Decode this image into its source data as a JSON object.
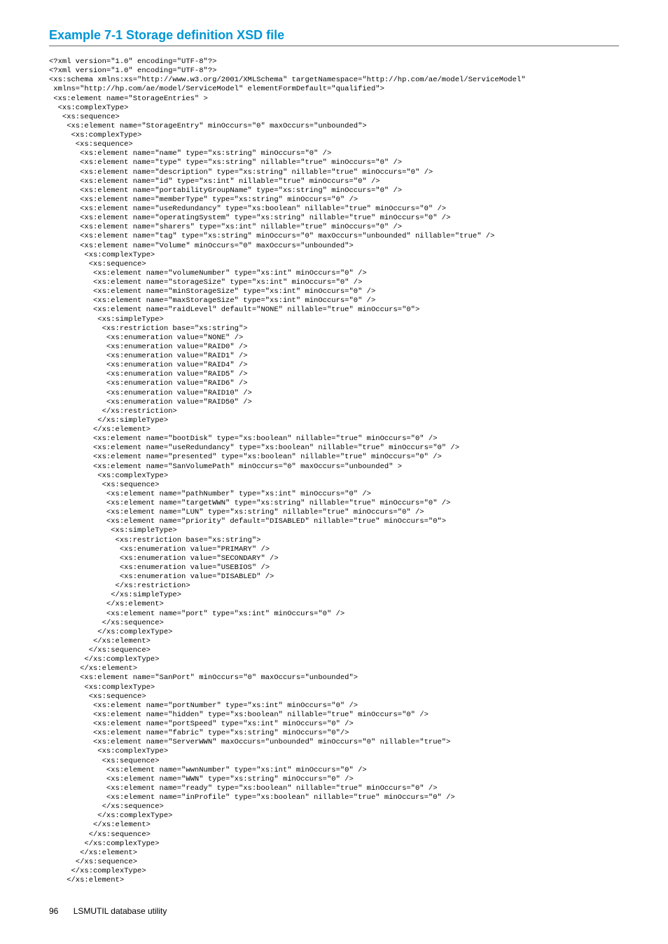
{
  "heading": "Example 7-1 Storage definition XSD file",
  "code": "<?xml version=\"1.0\" encoding=\"UTF-8\"?>\n<?xml version=\"1.0\" encoding=\"UTF-8\"?>\n<xs:schema xmlns:xs=\"http://www.w3.org/2001/XMLSchema\" targetNamespace=\"http://hp.com/ae/model/ServiceModel\"\n xmlns=\"http://hp.com/ae/model/ServiceModel\" elementFormDefault=\"qualified\">\n <xs:element name=\"StorageEntries\" >\n  <xs:complexType>\n   <xs:sequence>\n    <xs:element name=\"StorageEntry\" minOccurs=\"0\" maxOccurs=\"unbounded\">\n     <xs:complexType>\n      <xs:sequence>\n       <xs:element name=\"name\" type=\"xs:string\" minOccurs=\"0\" />\n       <xs:element name=\"type\" type=\"xs:string\" nillable=\"true\" minOccurs=\"0\" />\n       <xs:element name=\"description\" type=\"xs:string\" nillable=\"true\" minOccurs=\"0\" />\n       <xs:element name=\"id\" type=\"xs:int\" nillable=\"true\" minOccurs=\"0\" />\n       <xs:element name=\"portabilityGroupName\" type=\"xs:string\" minOccurs=\"0\" />\n       <xs:element name=\"memberType\" type=\"xs:string\" minOccurs=\"0\" />\n       <xs:element name=\"useRedundancy\" type=\"xs:boolean\" nillable=\"true\" minOccurs=\"0\" />\n       <xs:element name=\"operatingSystem\" type=\"xs:string\" nillable=\"true\" minOccurs=\"0\" />\n       <xs:element name=\"sharers\" type=\"xs:int\" nillable=\"true\" minOccurs=\"0\" />\n       <xs:element name=\"tag\" type=\"xs:string\" minOccurs=\"0\" maxOccurs=\"unbounded\" nillable=\"true\" />\n       <xs:element name=\"Volume\" minOccurs=\"0\" maxOccurs=\"unbounded\">\n        <xs:complexType>\n         <xs:sequence>\n          <xs:element name=\"volumeNumber\" type=\"xs:int\" minOccurs=\"0\" />\n          <xs:element name=\"storageSize\" type=\"xs:int\" minOccurs=\"0\" />\n          <xs:element name=\"minStorageSize\" type=\"xs:int\" minOccurs=\"0\" />\n          <xs:element name=\"maxStorageSize\" type=\"xs:int\" minOccurs=\"0\" />\n          <xs:element name=\"raidLevel\" default=\"NONE\" nillable=\"true\" minOccurs=\"0\">\n           <xs:simpleType>\n            <xs:restriction base=\"xs:string\">\n             <xs:enumeration value=\"NONE\" />\n             <xs:enumeration value=\"RAID0\" />\n             <xs:enumeration value=\"RAID1\" />\n             <xs:enumeration value=\"RAID4\" />\n             <xs:enumeration value=\"RAID5\" />\n             <xs:enumeration value=\"RAID6\" />\n             <xs:enumeration value=\"RAID10\" />\n             <xs:enumeration value=\"RAID50\" />\n            </xs:restriction>\n           </xs:simpleType>\n          </xs:element>\n          <xs:element name=\"bootDisk\" type=\"xs:boolean\" nillable=\"true\" minOccurs=\"0\" />\n          <xs:element name=\"useRedundancy\" type=\"xs:boolean\" nillable=\"true\" minOccurs=\"0\" />\n          <xs:element name=\"presented\" type=\"xs:boolean\" nillable=\"true\" minOccurs=\"0\" />\n          <xs:element name=\"SanVolumePath\" minOccurs=\"0\" maxOccurs=\"unbounded\" >\n           <xs:complexType>\n            <xs:sequence>\n             <xs:element name=\"pathNumber\" type=\"xs:int\" minOccurs=\"0\" />\n             <xs:element name=\"targetWWN\" type=\"xs:string\" nillable=\"true\" minOccurs=\"0\" />\n             <xs:element name=\"LUN\" type=\"xs:string\" nillable=\"true\" minOccurs=\"0\" />\n             <xs:element name=\"priority\" default=\"DISABLED\" nillable=\"true\" minOccurs=\"0\">\n              <xs:simpleType>\n               <xs:restriction base=\"xs:string\">\n                <xs:enumeration value=\"PRIMARY\" />\n                <xs:enumeration value=\"SECONDARY\" />\n                <xs:enumeration value=\"USEBIOS\" />\n                <xs:enumeration value=\"DISABLED\" />\n               </xs:restriction>\n              </xs:simpleType>\n             </xs:element>\n             <xs:element name=\"port\" type=\"xs:int\" minOccurs=\"0\" />\n            </xs:sequence>\n           </xs:complexType>\n          </xs:element>\n         </xs:sequence>\n        </xs:complexType>\n       </xs:element>\n       <xs:element name=\"SanPort\" minOccurs=\"0\" maxOccurs=\"unbounded\">\n        <xs:complexType>\n         <xs:sequence>\n          <xs:element name=\"portNumber\" type=\"xs:int\" minOccurs=\"0\" />\n          <xs:element name=\"hidden\" type=\"xs:boolean\" nillable=\"true\" minOccurs=\"0\" />\n          <xs:element name=\"portSpeed\" type=\"xs:int\" minOccurs=\"0\" />\n          <xs:element name=\"fabric\" type=\"xs:string\" minOccurs=\"0\"/>\n          <xs:element name=\"ServerWWN\" maxOccurs=\"unbounded\" minOccurs=\"0\" nillable=\"true\">\n           <xs:complexType>\n            <xs:sequence>\n             <xs:element name=\"wwnNumber\" type=\"xs:int\" minOccurs=\"0\" />\n             <xs:element name=\"WWN\" type=\"xs:string\" minOccurs=\"0\" />\n             <xs:element name=\"ready\" type=\"xs:boolean\" nillable=\"true\" minOccurs=\"0\" />\n             <xs:element name=\"inProfile\" type=\"xs:boolean\" nillable=\"true\" minOccurs=\"0\" />\n            </xs:sequence>\n           </xs:complexType>\n          </xs:element>\n         </xs:sequence>\n        </xs:complexType>\n       </xs:element>\n      </xs:sequence>\n     </xs:complexType>\n    </xs:element>",
  "footer": {
    "page": "96",
    "title": "LSMUTIL database utility"
  }
}
